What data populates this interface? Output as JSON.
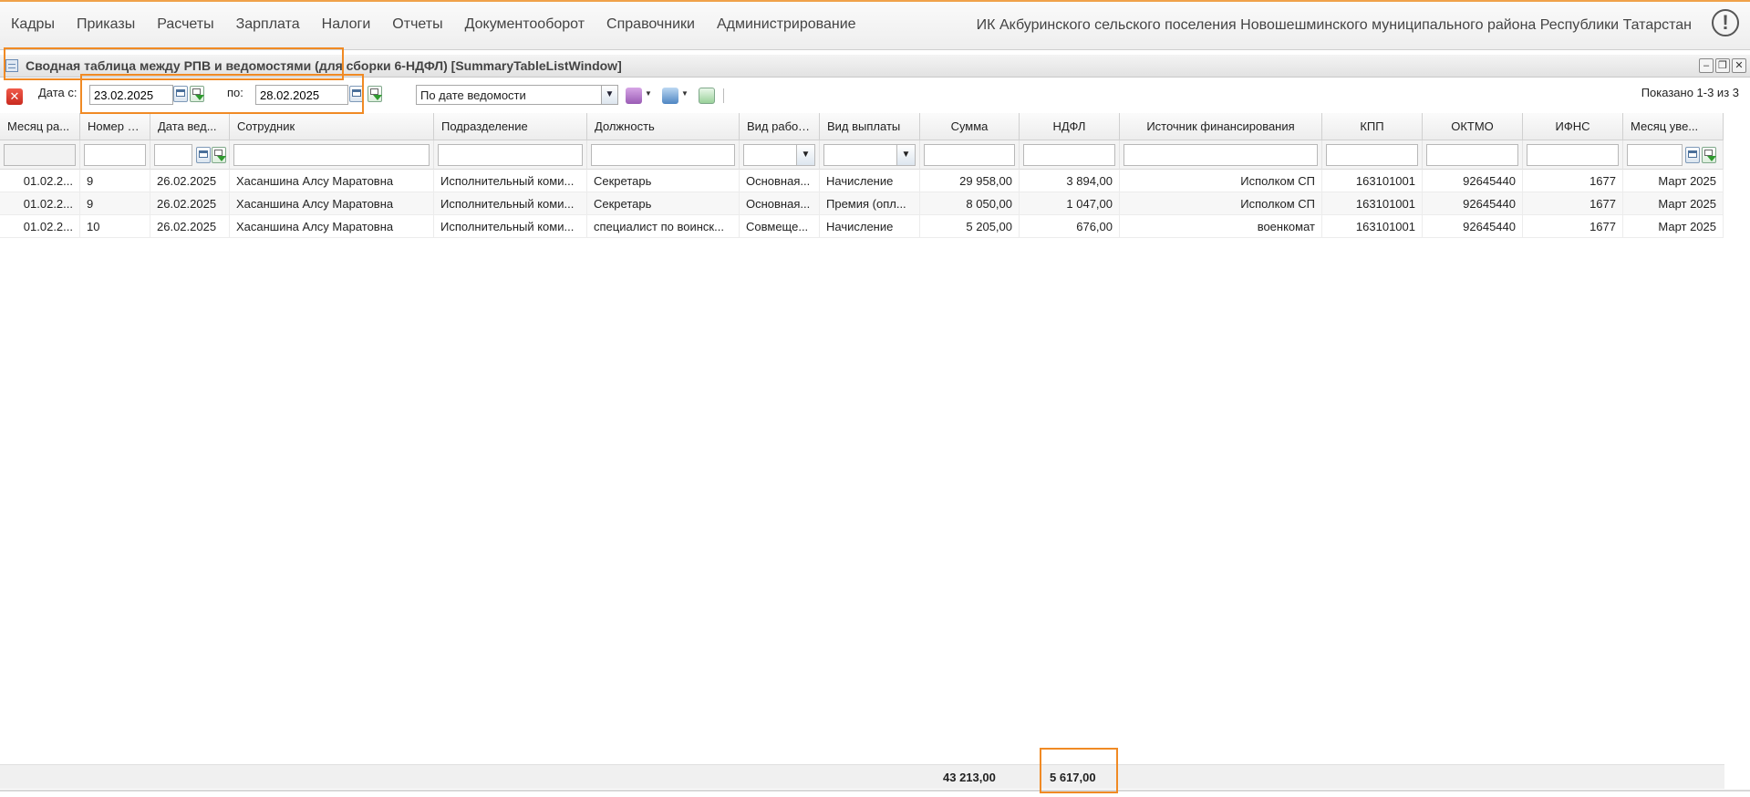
{
  "menu": [
    "Кадры",
    "Приказы",
    "Расчеты",
    "Зарплата",
    "Налоги",
    "Отчеты",
    "Документооборот",
    "Справочники",
    "Администрирование"
  ],
  "org_name": "ИК Акбуринского сельского поселения Новошешминского муниципального района Республики Татарстан",
  "info_glyph": "!",
  "window": {
    "title": "Сводная таблица между РПВ и ведомостями (для сборки 6-НДФЛ) [SummaryTableListWindow]"
  },
  "toolbar": {
    "cancel_glyph": "✕",
    "date_from_label": "Дата с:",
    "date_from": "23.02.2025",
    "date_to_label": "по:",
    "date_to": "28.02.2025",
    "mode": "По дате ведомости",
    "pager": "Показано 1-3 из 3"
  },
  "columns": [
    "Месяц ра...",
    "Номер в...",
    "Дата вед...",
    "Сотрудник",
    "Подразделение",
    "Должность",
    "Вид работы",
    "Вид выплаты",
    "Сумма",
    "НДФЛ",
    "Источник финансирования",
    "КПП",
    "ОКТМО",
    "ИФНС",
    "Месяц уве..."
  ],
  "rows": [
    [
      "01.02.2...",
      "9",
      "26.02.2025",
      "Хасаншина Алсу Маратовна",
      "Исполнительный коми...",
      "Секретарь",
      "Основная...",
      "Начисление",
      "29 958,00",
      "3 894,00",
      "Исполком СП",
      "163101001",
      "92645440",
      "1677",
      "Март 2025"
    ],
    [
      "01.02.2...",
      "9",
      "26.02.2025",
      "Хасаншина Алсу Маратовна",
      "Исполнительный коми...",
      "Секретарь",
      "Основная...",
      "Премия (опл...",
      "8 050,00",
      "1 047,00",
      "Исполком СП",
      "163101001",
      "92645440",
      "1677",
      "Март 2025"
    ],
    [
      "01.02.2...",
      "10",
      "26.02.2025",
      "Хасаншина Алсу Маратовна",
      "Исполнительный коми...",
      "специалист по воинск...",
      "Совмеще...",
      "Начисление",
      "5 205,00",
      "676,00",
      "военкомат",
      "163101001",
      "92645440",
      "1677",
      "Март 2025"
    ]
  ],
  "totals": {
    "summa": "43 213,00",
    "ndfl": "5 617,00"
  }
}
